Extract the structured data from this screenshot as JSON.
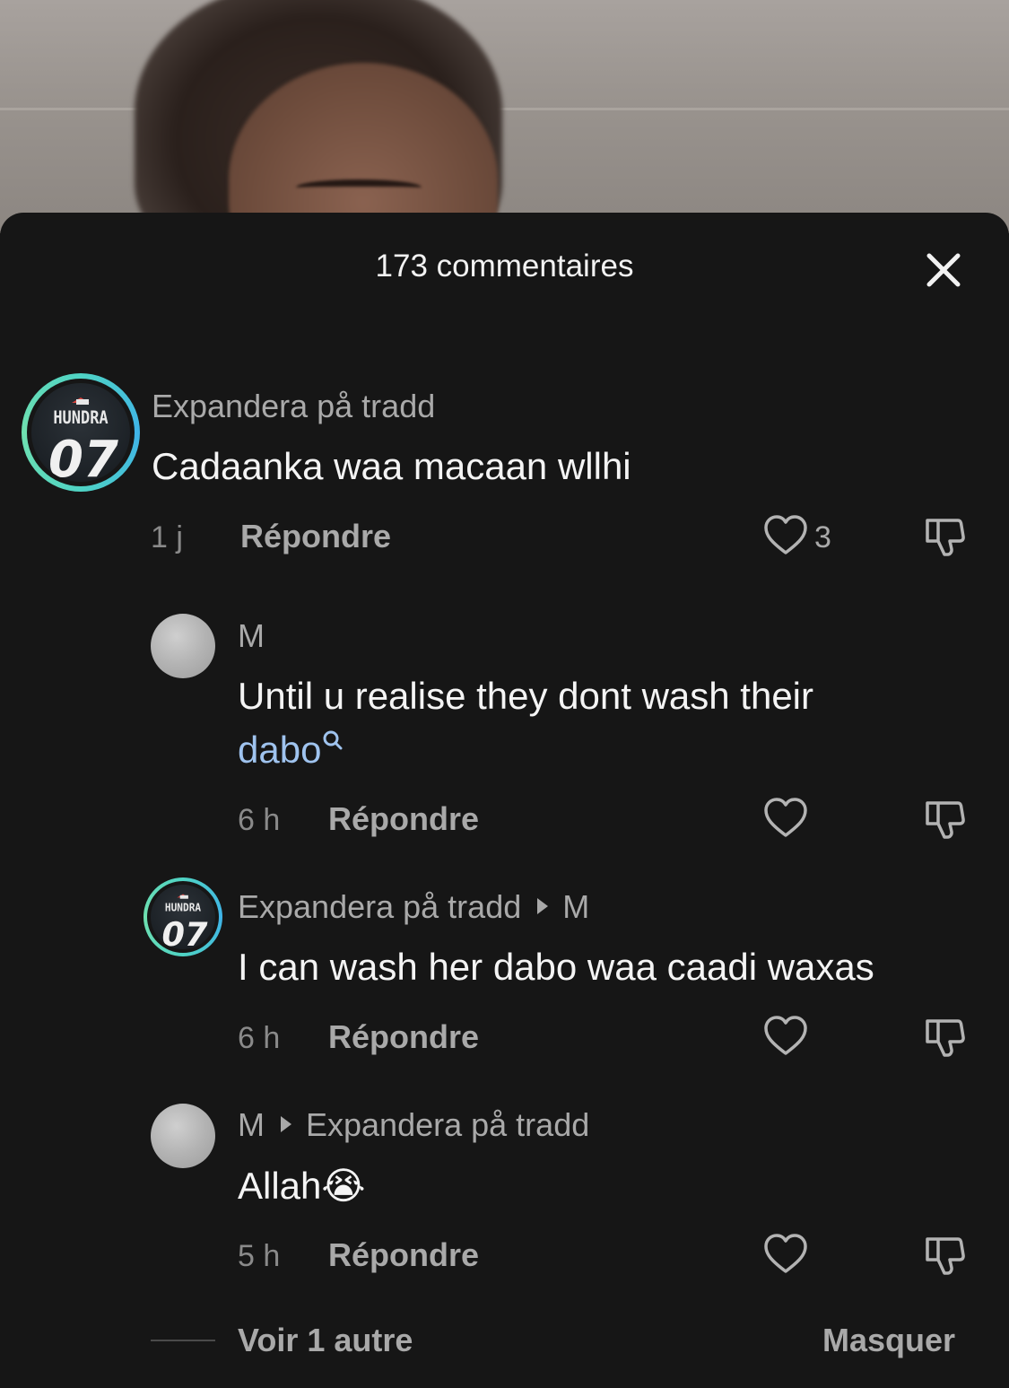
{
  "sheet": {
    "title": "173 commentaires",
    "close_icon": "close-icon"
  },
  "comments": [
    {
      "author": "Expandera på tradd",
      "avatar": "jersey-avatar",
      "avatar_text": "HUNDRA 07",
      "text": "Cadaanka waa macaan wllhi",
      "time": "1 j",
      "reply_label": "Répondre",
      "likes": "3"
    },
    {
      "author": "M",
      "avatar": "grey-avatar",
      "text": "Until u realise they dont wash their",
      "link_text": "dabo",
      "time": "6 h",
      "reply_label": "Répondre"
    },
    {
      "author": "Expandera på tradd",
      "reply_to": "M",
      "avatar": "jersey-avatar",
      "avatar_text": "HUNDRA 07",
      "text": "I can wash her dabo waa caadi waxas",
      "time": "6 h",
      "reply_label": "Répondre"
    },
    {
      "author": "M",
      "reply_to": "Expandera på tradd",
      "avatar": "grey-avatar",
      "text": "Allah",
      "emoji": "😭",
      "time": "5 h",
      "reply_label": "Répondre"
    }
  ],
  "footer": {
    "view_more": "Voir 1 autre",
    "hide": "Masquer"
  },
  "colors": {
    "background": "#161616",
    "accent_link": "#9fc3ee",
    "ring": "#4fd3c4"
  }
}
